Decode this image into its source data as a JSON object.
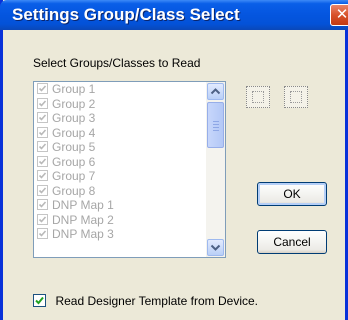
{
  "window": {
    "title": "Settings Group/Class Select",
    "close_glyph": "✕"
  },
  "groups_section": {
    "label": "Select Groups/Classes to Read",
    "items": [
      {
        "label": "Group 1",
        "checked": true
      },
      {
        "label": "Group 2",
        "checked": true
      },
      {
        "label": "Group 3",
        "checked": true
      },
      {
        "label": "Group 4",
        "checked": true
      },
      {
        "label": "Group 5",
        "checked": true
      },
      {
        "label": "Group 6",
        "checked": true
      },
      {
        "label": "Group 7",
        "checked": true
      },
      {
        "label": "Group 8",
        "checked": true
      },
      {
        "label": "DNP Map 1",
        "checked": true
      },
      {
        "label": "DNP Map 2",
        "checked": true
      },
      {
        "label": "DNP Map 3",
        "checked": true
      }
    ],
    "scroll_up_icon": "chevron-up-icon",
    "scroll_down_icon": "chevron-down-icon"
  },
  "buttons": {
    "ok_label": "OK",
    "cancel_label": "Cancel"
  },
  "read_template": {
    "label": "Read Designer Template from Device.",
    "checked": true
  },
  "colors": {
    "titlebar": "#0556e0",
    "close_button": "#d8522a",
    "dialog_background": "#ece9d8",
    "disabled_text": "#a6a6a6"
  }
}
